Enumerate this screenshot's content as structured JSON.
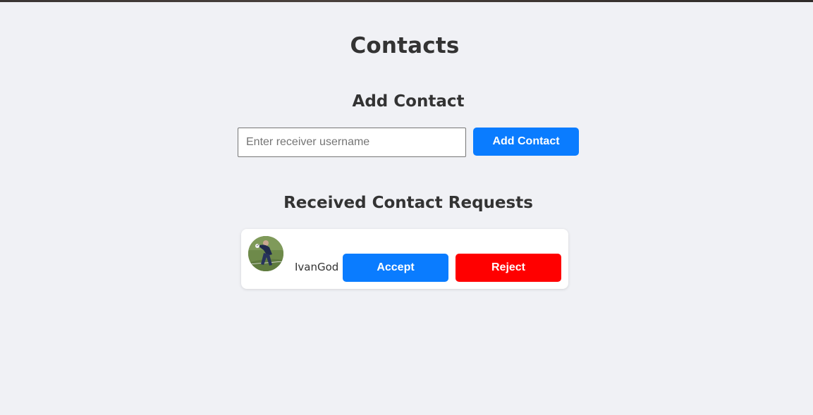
{
  "page": {
    "title": "Contacts"
  },
  "add_contact": {
    "heading": "Add Contact",
    "input_placeholder": "Enter receiver username",
    "input_value": "",
    "button_label": "Add Contact"
  },
  "requests": {
    "heading": "Received Contact Requests",
    "items": [
      {
        "username": "IvanGod",
        "avatar_icon": "user-photo-avatar",
        "accept_label": "Accept",
        "reject_label": "Reject"
      }
    ]
  },
  "colors": {
    "background": "#f0f1f5",
    "primary": "#0a7cff",
    "danger": "#ff0000",
    "card": "#ffffff",
    "text": "#333333"
  }
}
